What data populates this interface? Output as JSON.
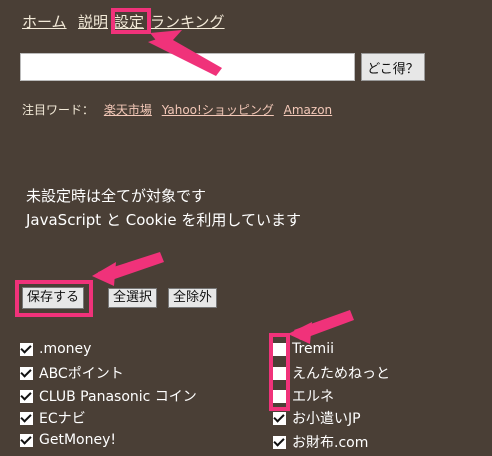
{
  "nav": {
    "home": "ホーム",
    "explain": "説明",
    "settings": "設定",
    "ranking": "ランキング"
  },
  "search": {
    "value": "",
    "placeholder": "",
    "button": "どこ得？"
  },
  "attention": {
    "label": "注目ワード：",
    "links": [
      "楽天市場",
      "Yahoo!ショッピング",
      "Amazon"
    ]
  },
  "notes": {
    "line1": "未設定時は全てが対象です",
    "line2": "JavaScript と Cookie を利用しています"
  },
  "buttons": {
    "save": "保存する",
    "select_all": "全選択",
    "clear_all": "全除外"
  },
  "left_items": [
    {
      "label": ".money",
      "checked": true
    },
    {
      "label": "ABCポイント",
      "checked": true
    },
    {
      "label": "CLUB Panasonic コイン",
      "checked": true
    },
    {
      "label": "ECナビ",
      "checked": true
    },
    {
      "label": "GetMoney!",
      "checked": true
    }
  ],
  "right_items": [
    {
      "label": "Tremii",
      "checked": false
    },
    {
      "label": "えんためねっと",
      "checked": false
    },
    {
      "label": "エルネ",
      "checked": false
    },
    {
      "label": "お小遣いJP",
      "checked": true
    },
    {
      "label": "お財布.com",
      "checked": true
    }
  ],
  "colors": {
    "background": "#4a3f36",
    "highlight": "#f0327a",
    "link": "#f3ead8"
  }
}
